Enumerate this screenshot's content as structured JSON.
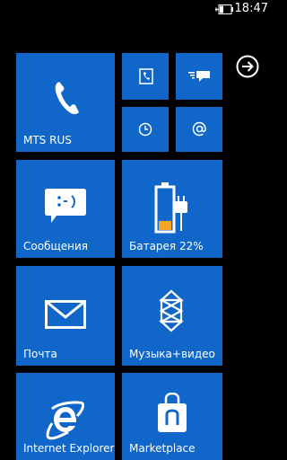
{
  "status_bar": {
    "time": "18:47",
    "battery_icon": "battery-charging-icon"
  },
  "tiles": {
    "phone": {
      "label": "MTS RUS",
      "icon": "phone-icon"
    },
    "people": {
      "icon": "contact-card-icon"
    },
    "messaging": {
      "icon": "messaging-icon"
    },
    "alarm": {
      "icon": "clock-icon"
    },
    "email": {
      "icon": "at-sign-icon"
    },
    "sms": {
      "label": "Сообщения",
      "icon": "smiley-speech-bubble-icon"
    },
    "battery": {
      "label": "Батарея 22%",
      "icon": "battery-plug-icon",
      "level": 0.22
    },
    "mail": {
      "label": "Почта",
      "icon": "envelope-icon"
    },
    "music": {
      "label": "Музыка+видео",
      "icon": "zune-icon"
    },
    "ie": {
      "label": "Internet Explorer",
      "icon": "internet-explorer-icon"
    },
    "marketplace": {
      "label": "Marketplace",
      "icon": "shopping-bag-icon"
    }
  },
  "navigation": {
    "arrow_icon": "arrow-right-circle-icon"
  },
  "colors": {
    "background": "#000000",
    "tile_accent": "#1167c9",
    "battery_low": "#f5a623"
  }
}
